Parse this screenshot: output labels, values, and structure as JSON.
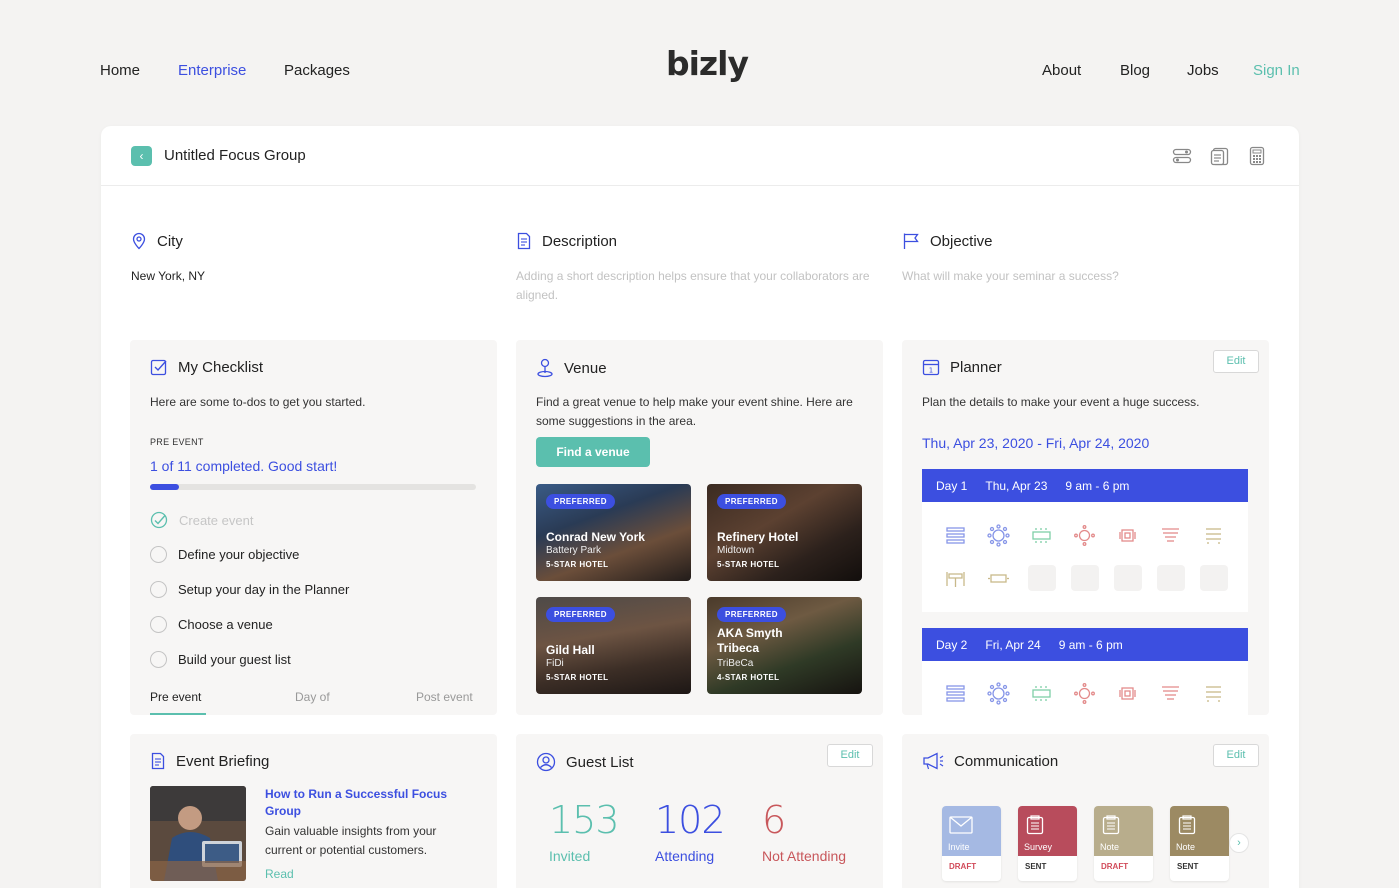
{
  "nav": {
    "left": [
      "Home",
      "Enterprise",
      "Packages"
    ],
    "logo": "bizly",
    "right": [
      "About",
      "Blog",
      "Jobs"
    ],
    "signin": "Sign In"
  },
  "event": {
    "title": "Untitled Focus Group"
  },
  "info": {
    "city_label": "City",
    "city_value": "New York, NY",
    "description_label": "Description",
    "description_placeholder": "Adding a short description helps ensure that your collaborators are aligned.",
    "objective_label": "Objective",
    "objective_placeholder": "What will make your seminar a success?"
  },
  "checklist": {
    "title": "My Checklist",
    "intro": "Here are some to-dos to get you started.",
    "section": "PRE EVENT",
    "progress_text": "1 of 11 completed. Good start!",
    "progress": 0.09,
    "items": [
      {
        "label": "Create event",
        "done": true
      },
      {
        "label": "Define your objective",
        "done": false
      },
      {
        "label": "Setup your day in the Planner",
        "done": false
      },
      {
        "label": "Choose a venue",
        "done": false
      },
      {
        "label": "Build your guest list",
        "done": false
      }
    ],
    "tabs": [
      "Pre event",
      "Day of",
      "Post event"
    ]
  },
  "venue": {
    "title": "Venue",
    "desc": "Find a great venue to help make your event shine. Here are some suggestions in the area.",
    "find_button": "Find a venue",
    "cards": [
      {
        "badge": "PREFERRED",
        "name": "Conrad New York",
        "hood": "Battery Park",
        "type": "5-STAR HOTEL"
      },
      {
        "badge": "PREFERRED",
        "name": "Refinery Hotel",
        "hood": "Midtown",
        "type": "5-STAR HOTEL"
      },
      {
        "badge": "PREFERRED",
        "name": "Gild Hall",
        "hood": "FiDi",
        "type": "5-STAR HOTEL"
      },
      {
        "badge": "PREFERRED",
        "name": "AKA Smyth Tribeca",
        "hood": "TriBeCa",
        "type": "4-STAR HOTEL"
      }
    ]
  },
  "planner": {
    "title": "Planner",
    "edit": "Edit",
    "desc": "Plan the details to make your event a huge success.",
    "date_range": "Thu, Apr 23, 2020 - Fri, Apr 24, 2020",
    "days": [
      {
        "day": "Day 1",
        "date": "Thu, Apr 23",
        "time": "9 am - 6 pm"
      },
      {
        "day": "Day 2",
        "date": "Fri, Apr 24",
        "time": "9 am - 6 pm"
      }
    ]
  },
  "briefing": {
    "title": "Event Briefing",
    "article_title": "How to Run a Successful Focus Group",
    "article_desc": "Gain valuable insights from your current or potential customers.",
    "read": "Read"
  },
  "guests": {
    "title": "Guest List",
    "edit": "Edit",
    "invited_num": "153",
    "invited_label": "Invited",
    "attending_num": "102",
    "attending_label": "Attending",
    "not_attending_num": "6",
    "not_attending_label": "Not Attending"
  },
  "communication": {
    "title": "Communication",
    "edit": "Edit",
    "cards": [
      {
        "label": "Invite",
        "status": "DRAFT",
        "color": "#a5b9e3"
      },
      {
        "label": "Survey",
        "status": "SENT",
        "color": "#b84c5c"
      },
      {
        "label": "Note",
        "status": "DRAFT",
        "color": "#b8ad8c"
      },
      {
        "label": "Note",
        "status": "SENT",
        "color": "#9c8a63"
      }
    ]
  },
  "colors": {
    "accent_blue": "#3c4fe0",
    "accent_teal": "#5bbfae",
    "not_attending": "#c8575b",
    "draft": "#d14b5a"
  },
  "icons": [
    "location-pin-icon",
    "document-icon",
    "flag-icon",
    "checkbox-icon",
    "venue-pin-icon",
    "calendar-icon",
    "article-icon",
    "user-circle-icon",
    "megaphone-icon",
    "toggle-icon",
    "notes-icon",
    "calculator-icon"
  ]
}
